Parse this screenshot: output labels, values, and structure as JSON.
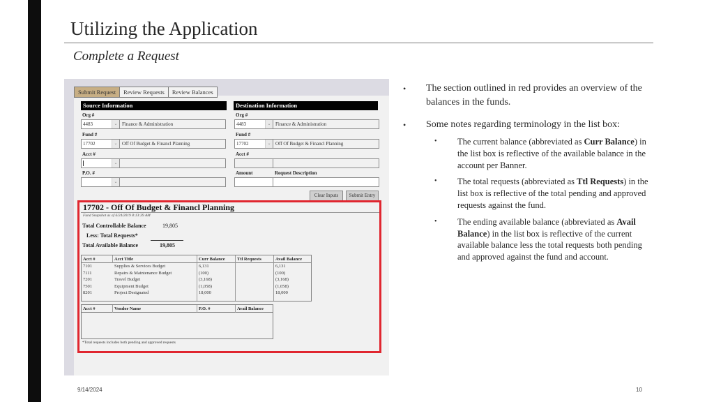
{
  "slide": {
    "title": "Utilizing the Application",
    "subtitle": "Complete a Request",
    "footer_date": "9/14/2024",
    "page_number": "10"
  },
  "app": {
    "tabs": [
      {
        "label": "Submit Request",
        "active": true
      },
      {
        "label": "Review Requests",
        "active": false
      },
      {
        "label": "Review Balances",
        "active": false
      }
    ],
    "source": {
      "header": "Source Information",
      "org_label": "Org #",
      "org_value": "4483",
      "org_desc": "Finance & Administration",
      "fund_label": "Fund #",
      "fund_value": "17702",
      "fund_desc": "Off Of Budget & Financl Planning",
      "acct_label": "Acct #",
      "acct_value": "",
      "acct_desc": "",
      "po_label": "P.O. #",
      "po_value": "",
      "po_desc": ""
    },
    "destination": {
      "header": "Destination Information",
      "org_label": "Org #",
      "org_value": "4483",
      "org_desc": "Finance & Administration",
      "fund_label": "Fund #",
      "fund_value": "17702",
      "fund_desc": "Off Of Budget & Financl Planning",
      "acct_label": "Acct #",
      "acct_value": "",
      "acct_desc": "",
      "amount_label": "Amount",
      "amount_value": "",
      "desc_label": "Request Description",
      "desc_value": ""
    },
    "buttons": {
      "clear": "Clear Inputs",
      "submit": "Submit Entry"
    },
    "overview": {
      "fund_title": "17702 - Off Of Budget & Financl Planning",
      "snapshot": "Fund Snapshot as of 6/24/2019 8:13:39 AM",
      "total_controllable_label": "Total Controllable Balance",
      "total_controllable_value": "19,805",
      "less_requests_label": "Less: Total Requests*",
      "less_requests_value": "",
      "total_available_label": "Total Available Balance",
      "total_available_value": "19,805",
      "accounts_table": {
        "headers": [
          "Acct #",
          "Acct Title",
          "Curr Balance",
          "Ttl Requests",
          "Avail Balance"
        ],
        "rows": [
          [
            "7101",
            "Supplies & Services Budget",
            "6,131",
            "",
            "6,131"
          ],
          [
            "7111",
            "Repairs & Maintenance Budget",
            "(100)",
            "",
            "(100)"
          ],
          [
            "7201",
            "Travel Budget",
            "(3,168)",
            "",
            "(3,168)"
          ],
          [
            "7501",
            "Equipment Budget",
            "(1,058)",
            "",
            "(1,058)"
          ],
          [
            "8201",
            "Project Designated",
            "18,000",
            "",
            "18,000"
          ]
        ]
      },
      "po_table": {
        "headers": [
          "Acct #",
          "Vendor Name",
          "P.O. #",
          "Avail Balance"
        ],
        "rows": []
      },
      "footnote": "*Total requests includes both pending and approved requests"
    }
  },
  "bullets": [
    {
      "text": "The section outlined in red provides an overview of the balances in the funds."
    },
    {
      "text": "Some notes regarding terminology in the list box:"
    }
  ],
  "sub_bullets": [
    {
      "pre": "The current balance (abbreviated as ",
      "bold": "Curr Balance",
      "post": ") in the list box is reflective of the available balance in the account per Banner."
    },
    {
      "pre": "The total requests (abbreviated as ",
      "bold": "Ttl Requests",
      "post": ") in the list box is reflective of the total pending and approved requests against the fund."
    },
    {
      "pre": "The ending available balance (abbreviated as ",
      "bold": "Avail Balance",
      "post": ") in the list box is reflective of the current available balance less the total requests both pending and approved against the fund and account."
    }
  ],
  "colors": {
    "highlight_border": "#e0262f",
    "active_tab": "#c7ae84",
    "section_header_bg": "#000000"
  }
}
